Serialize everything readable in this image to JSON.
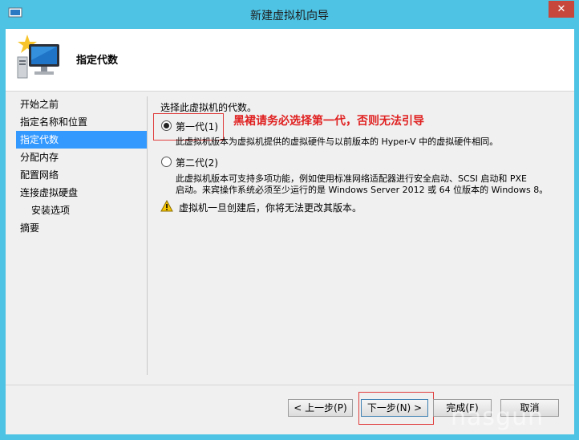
{
  "window": {
    "title": "新建虚拟机向导",
    "close_label": "✕"
  },
  "header": {
    "title": "指定代数"
  },
  "nav": {
    "items": [
      {
        "label": "开始之前"
      },
      {
        "label": "指定名称和位置"
      },
      {
        "label": "指定代数"
      },
      {
        "label": "分配内存"
      },
      {
        "label": "配置网络"
      },
      {
        "label": "连接虚拟硬盘"
      },
      {
        "label": "安装选项"
      },
      {
        "label": "摘要"
      }
    ],
    "active_index": 2
  },
  "content": {
    "instruction": "选择此虚拟机的代数。",
    "annotation": "黑裙请务必选择第一代，否则无法引导",
    "gen1": {
      "label": "第一代(1)",
      "selected": true,
      "description": "此虚拟机版本为虚拟机提供的虚拟硬件与以前版本的 Hyper-V 中的虚拟硬件相同。"
    },
    "gen2": {
      "label": "第二代(2)",
      "selected": false,
      "description_line1": "此虚拟机版本可支持多项功能，例如使用标准网络适配器进行安全启动、SCSI 启动和 PXE",
      "description_line2": "启动。来宾操作系统必须至少运行的是 Windows Server 2012 或 64 位版本的 Windows 8。"
    },
    "warning": "虚拟机一旦创建后，你将无法更改其版本。"
  },
  "buttons": {
    "prev": "< 上一步(P)",
    "next": "下一步(N) >",
    "finish": "完成(F)",
    "cancel": "取消"
  },
  "watermark": {
    "text": "nasgun"
  },
  "colors": {
    "titlebar": "#4ec3e4",
    "selection": "#3399ff",
    "annotation": "#e02020",
    "close": "#c7473c"
  }
}
